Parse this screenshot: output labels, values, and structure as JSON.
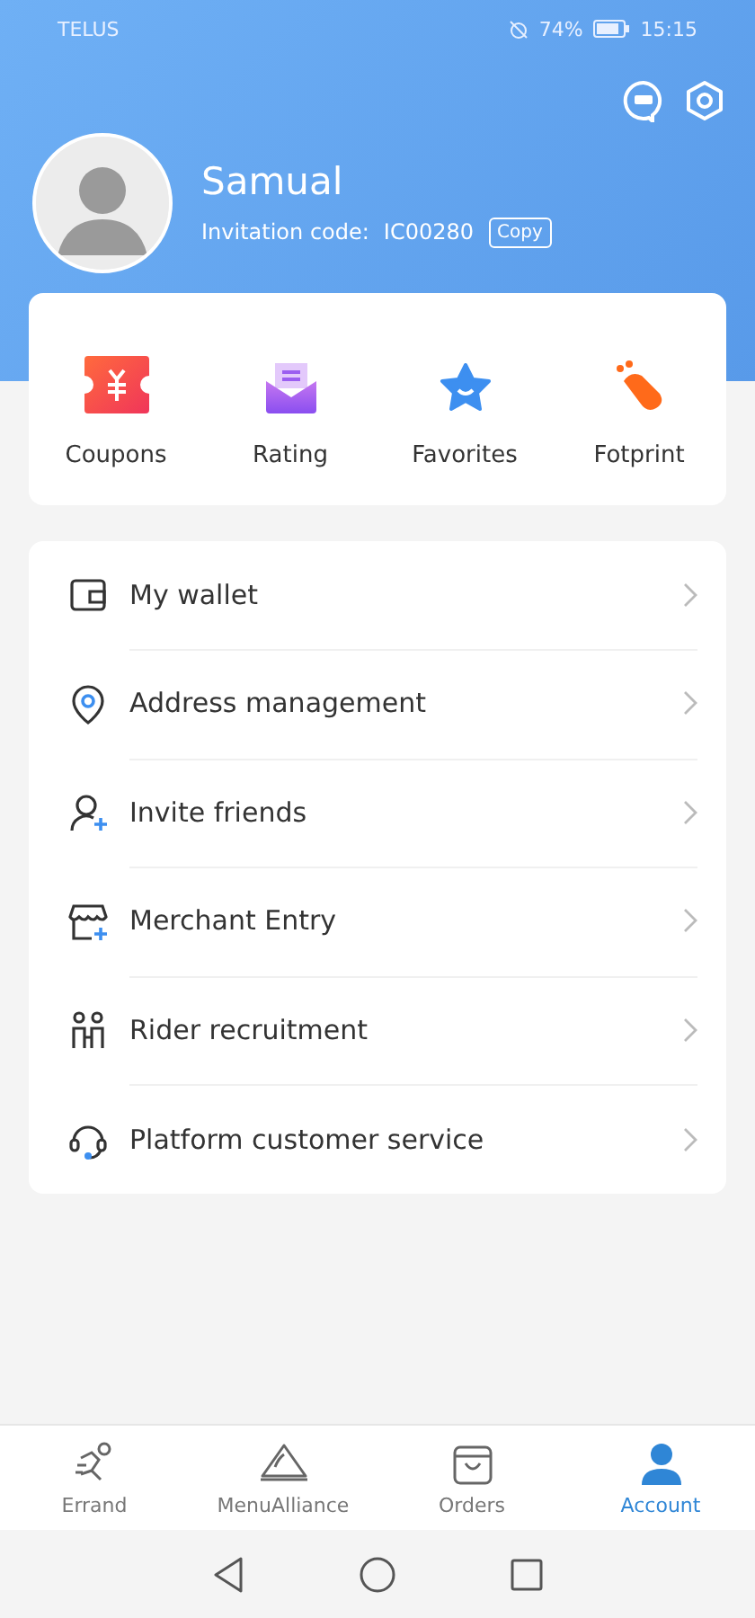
{
  "status_bar": {
    "carrier": "TELUS",
    "battery": "74%",
    "time": "15:15"
  },
  "profile": {
    "name": "Samual",
    "invitation_label": "Invitation code:",
    "invitation_code": "IC00280",
    "copy_button": "Copy"
  },
  "shortcuts": [
    {
      "label": "Coupons"
    },
    {
      "label": "Rating"
    },
    {
      "label": "Favorites"
    },
    {
      "label": "Fotprint"
    }
  ],
  "menu": [
    {
      "label": "My wallet"
    },
    {
      "label": "Address management"
    },
    {
      "label": "Invite friends"
    },
    {
      "label": "Merchant Entry"
    },
    {
      "label": "Rider recruitment"
    },
    {
      "label": "Platform customer service"
    }
  ],
  "bottom_nav": [
    {
      "label": "Errand",
      "selected": false
    },
    {
      "label": "MenuAlliance",
      "selected": false
    },
    {
      "label": "Orders",
      "selected": false
    },
    {
      "label": "Account",
      "selected": true
    }
  ]
}
